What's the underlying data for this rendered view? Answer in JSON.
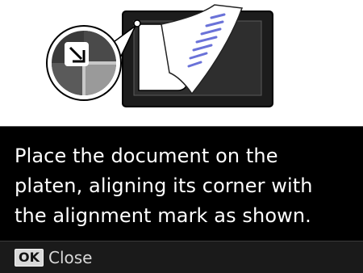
{
  "screen": {
    "message": "Place the document on the\nplaten, aligning its corner with\nthe alignment mark as shown."
  },
  "illustration": {
    "icon": "alignment-mark-illustration"
  },
  "softkey": {
    "key_label": "OK",
    "action_label": "Close"
  },
  "colors": {
    "panel_background": "#000000",
    "softkey_background": "#1a1a1a",
    "text": "#ffffff"
  }
}
